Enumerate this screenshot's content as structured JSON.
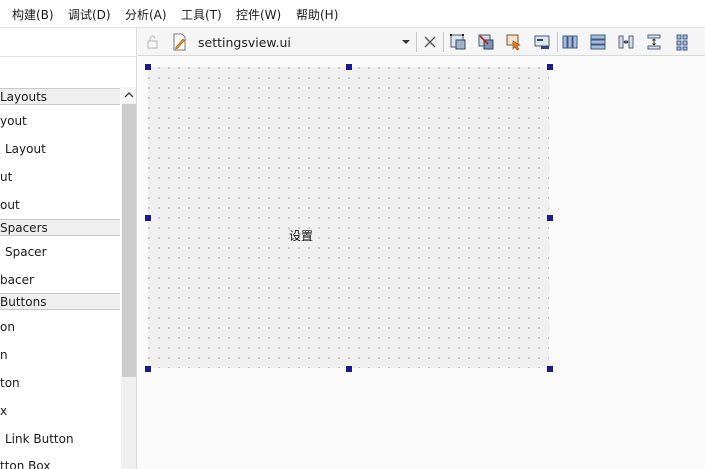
{
  "menu": [
    "构建(B)",
    "调试(D)",
    "分析(A)",
    "工具(T)",
    "控件(W)",
    "帮助(H)"
  ],
  "toolbar": {
    "file_name": "settingsview.ui",
    "icons": [
      "lock-icon",
      "file-edit-icon",
      "dropdown-arrow-icon",
      "close-icon",
      "edit-widgets-icon",
      "edit-signals-slots-icon",
      "edit-buddies-icon",
      "edit-tab-order-icon",
      "layout-horizontal-icon",
      "layout-vertical-icon",
      "layout-horizontal-splitter-icon",
      "layout-vertical-splitter-icon",
      "layout-grid-icon"
    ]
  },
  "widget_box": {
    "categories": [
      {
        "label": "Layouts",
        "items": [
          "yout",
          "Layout",
          "ut",
          "out"
        ]
      },
      {
        "label": "Spacers",
        "items": [
          "Spacer",
          "bacer"
        ]
      },
      {
        "label": "Buttons",
        "items": [
          "on",
          "n",
          "ton",
          "x",
          "Link Button",
          "tton Box"
        ]
      }
    ]
  },
  "form": {
    "label": "设置"
  },
  "colors": {
    "selection_handle": "#1a1a8c",
    "form_background": "#f0f0f0",
    "grid_dot": "#a9a9a9"
  }
}
